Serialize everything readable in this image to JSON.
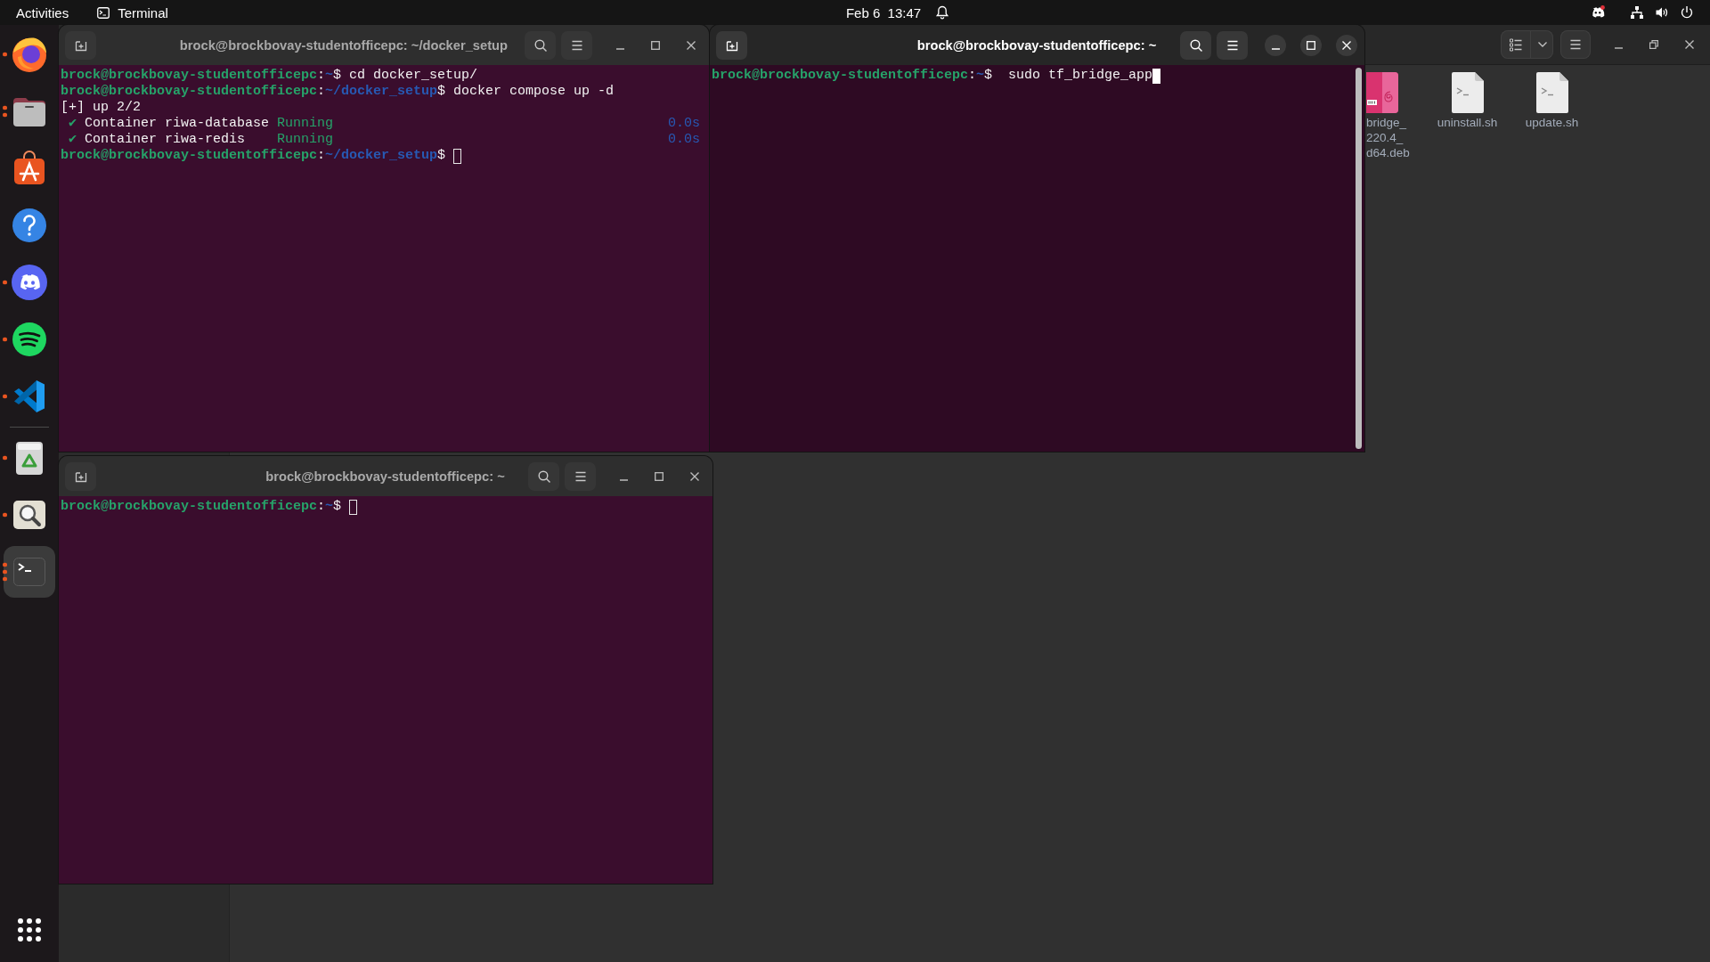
{
  "top_bar": {
    "activities": "Activities",
    "app_menu": "Terminal",
    "clock": "Feb 6  13:47"
  },
  "dock": {
    "favorites": [
      {
        "kind": "browser",
        "selected": false,
        "windows": [
          {
            "open": true
          }
        ]
      },
      {
        "kind": "files",
        "selected": false,
        "windows": [
          {
            "open": true
          },
          {
            "open": true
          }
        ]
      },
      {
        "kind": "store",
        "selected": false
      },
      {
        "kind": "help",
        "selected": false
      },
      {
        "kind": "chat",
        "selected": false,
        "windows": [
          {
            "open": true
          }
        ]
      },
      {
        "kind": "music",
        "selected": false,
        "windows": [
          {
            "open": true
          }
        ]
      },
      {
        "kind": "editor",
        "selected": false,
        "windows": [
          {
            "open": true
          }
        ]
      }
    ],
    "running": [
      {
        "kind": "recycler",
        "selected": false,
        "windows": [
          {
            "open": true
          }
        ]
      },
      {
        "kind": "viewer",
        "selected": false,
        "windows": [
          {
            "open": true
          }
        ]
      },
      {
        "kind": "terminal",
        "selected": true,
        "windows": [
          {
            "open": true
          },
          {
            "open": true
          },
          {
            "open": true
          }
        ]
      }
    ]
  },
  "file_manager": {
    "files": [
      {
        "kind": "package",
        "name_lines": [
          "bridge_",
          "220.4_",
          "d64.deb"
        ]
      },
      {
        "kind": "script",
        "name_lines": [
          "uninstall.sh"
        ]
      },
      {
        "kind": "script",
        "name_lines": [
          "update.sh"
        ]
      }
    ]
  },
  "terminals": [
    {
      "title": "brock@brockbovay-studentofficepc: ~/docker_setup",
      "focused": false,
      "lines": [
        {
          "segments": [
            {
              "kind": "host",
              "text": "brock@brockbovay-studentofficepc"
            },
            {
              "kind": "plain",
              "text": ":"
            },
            {
              "kind": "path",
              "text": "~"
            },
            {
              "kind": "plain",
              "text": "$ cd docker_setup/"
            }
          ]
        },
        {
          "segments": [
            {
              "kind": "host",
              "text": "brock@brockbovay-studentofficepc"
            },
            {
              "kind": "plain",
              "text": ":"
            },
            {
              "kind": "path",
              "text": "~/docker_setup"
            },
            {
              "kind": "plain",
              "text": "$ docker compose up -d"
            }
          ]
        },
        {
          "segments": [
            {
              "kind": "plain",
              "text": "[+] up 2/2"
            }
          ]
        },
        {
          "segments": [
            {
              "kind": "check",
              "text": "✔"
            },
            {
              "kind": "plain",
              "text": " Container riwa-database "
            },
            {
              "kind": "status",
              "text": "Running"
            }
          ],
          "elapsed": "0.0s"
        },
        {
          "segments": [
            {
              "kind": "check",
              "text": "✔"
            },
            {
              "kind": "plain",
              "text": " Container riwa-redis    "
            },
            {
              "kind": "status",
              "text": "Running"
            }
          ],
          "elapsed": "0.0s"
        },
        {
          "segments": [
            {
              "kind": "host",
              "text": "brock@brockbovay-studentofficepc"
            },
            {
              "kind": "plain",
              "text": ":"
            },
            {
              "kind": "path",
              "text": "~/docker_setup"
            },
            {
              "kind": "plain",
              "text": "$ "
            }
          ]
        }
      ]
    },
    {
      "title": "brock@brockbovay-studentofficepc: ~",
      "focused": true,
      "lines": [
        {
          "segments": [
            {
              "kind": "host",
              "text": "brock@brockbovay-studentofficepc"
            },
            {
              "kind": "plain",
              "text": ":"
            },
            {
              "kind": "path",
              "text": "~"
            },
            {
              "kind": "plain",
              "text": "$  sudo tf_bridge_app"
            }
          ]
        }
      ]
    },
    {
      "title": "brock@brockbovay-studentofficepc: ~",
      "focused": false,
      "lines": [
        {
          "segments": [
            {
              "kind": "host",
              "text": "brock@brockbovay-studentofficepc"
            },
            {
              "kind": "plain",
              "text": ":"
            },
            {
              "kind": "path",
              "text": "~"
            },
            {
              "kind": "plain",
              "text": "$ "
            }
          ]
        }
      ]
    }
  ]
}
